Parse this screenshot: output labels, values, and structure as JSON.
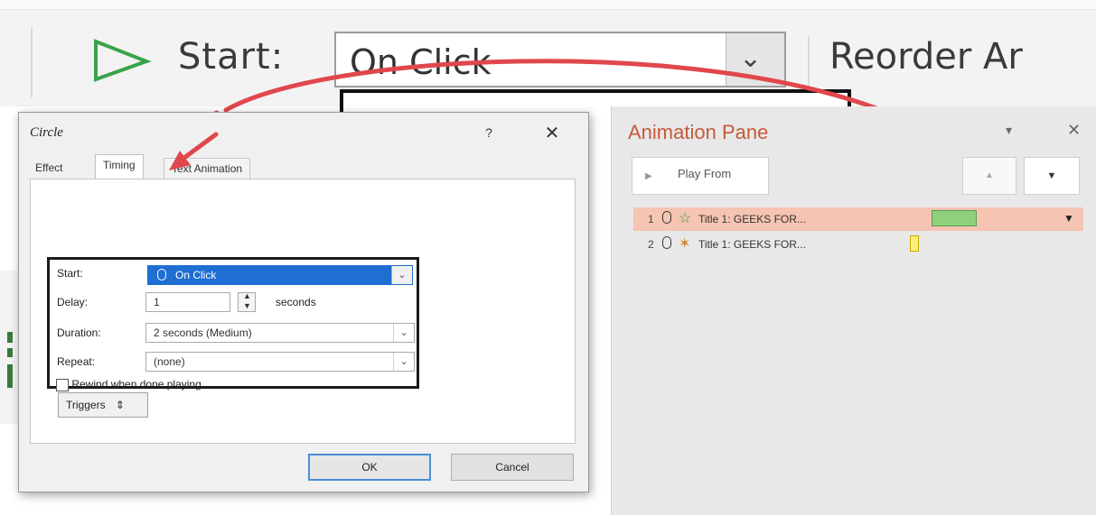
{
  "ribbon": {
    "start_label": "Start:",
    "start_value": "On Click",
    "reorder_label": "Reorder Ar"
  },
  "dialog": {
    "title": "Circle",
    "help": "?",
    "close": "✕",
    "tabs": [
      {
        "label": "Effect"
      },
      {
        "label": "Timing"
      },
      {
        "label": "Text Animation"
      }
    ],
    "start_label": "Start:",
    "start_value": "On Click",
    "delay_label": "Delay:",
    "delay_value": "1",
    "delay_unit": "seconds",
    "duration_label": "Duration:",
    "duration_value": "2 seconds (Medium)",
    "repeat_label": "Repeat:",
    "repeat_value": "(none)",
    "rewind_label": "Rewind when done playing",
    "triggers_label": "Triggers",
    "ok_label": "OK",
    "cancel_label": "Cancel"
  },
  "pane": {
    "title": "Animation Pane",
    "play_from": "Play From",
    "items": [
      {
        "num": "1",
        "label": "Title 1: GEEKS FOR...",
        "star_color": "#3a9a3a"
      },
      {
        "num": "2",
        "label": "Title 1: GEEKS FOR...",
        "star_color": "#d8822a"
      }
    ]
  },
  "colors": {
    "accent_red": "#e0474c",
    "pane_title": "#c55a3b",
    "selected_row": "#f5c4b2",
    "selection_blue": "#1f6ed1"
  }
}
